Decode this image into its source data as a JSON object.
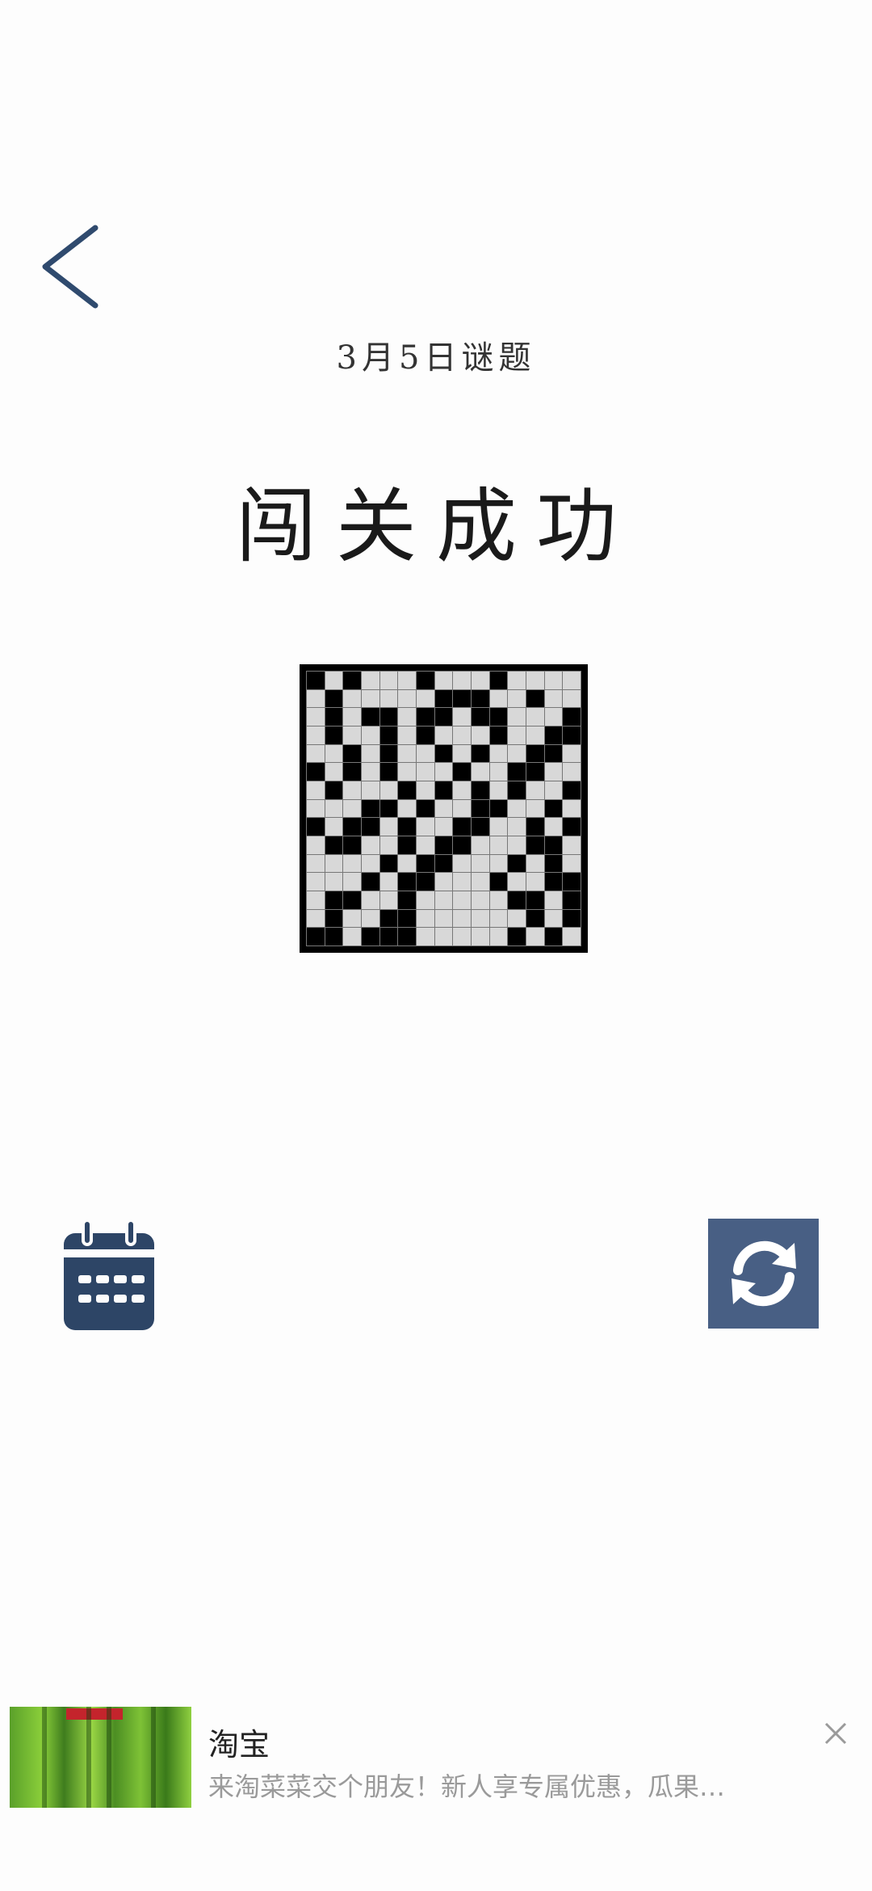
{
  "header": {
    "back_icon": "chevron-left-icon"
  },
  "puzzle": {
    "date_title": "3月5日谜题",
    "status_title": "闯关成功",
    "size": 15,
    "filled_cells": [
      [
        0,
        0
      ],
      [
        0,
        2
      ],
      [
        0,
        6
      ],
      [
        0,
        10
      ],
      [
        1,
        1
      ],
      [
        1,
        7
      ],
      [
        1,
        8
      ],
      [
        1,
        9
      ],
      [
        1,
        12
      ],
      [
        2,
        1
      ],
      [
        2,
        3
      ],
      [
        2,
        4
      ],
      [
        2,
        6
      ],
      [
        2,
        7
      ],
      [
        2,
        9
      ],
      [
        2,
        10
      ],
      [
        2,
        14
      ],
      [
        3,
        1
      ],
      [
        3,
        4
      ],
      [
        3,
        6
      ],
      [
        3,
        10
      ],
      [
        3,
        13
      ],
      [
        3,
        14
      ],
      [
        4,
        2
      ],
      [
        4,
        4
      ],
      [
        4,
        7
      ],
      [
        4,
        9
      ],
      [
        4,
        12
      ],
      [
        4,
        13
      ],
      [
        5,
        0
      ],
      [
        5,
        2
      ],
      [
        5,
        4
      ],
      [
        5,
        8
      ],
      [
        5,
        11
      ],
      [
        5,
        12
      ],
      [
        6,
        1
      ],
      [
        6,
        5
      ],
      [
        6,
        7
      ],
      [
        6,
        9
      ],
      [
        6,
        11
      ],
      [
        6,
        14
      ],
      [
        7,
        3
      ],
      [
        7,
        4
      ],
      [
        7,
        6
      ],
      [
        7,
        9
      ],
      [
        7,
        10
      ],
      [
        7,
        13
      ],
      [
        8,
        0
      ],
      [
        8,
        2
      ],
      [
        8,
        3
      ],
      [
        8,
        5
      ],
      [
        8,
        8
      ],
      [
        8,
        9
      ],
      [
        8,
        12
      ],
      [
        8,
        14
      ],
      [
        9,
        1
      ],
      [
        9,
        2
      ],
      [
        9,
        5
      ],
      [
        9,
        7
      ],
      [
        9,
        8
      ],
      [
        9,
        12
      ],
      [
        9,
        13
      ],
      [
        10,
        4
      ],
      [
        10,
        6
      ],
      [
        10,
        7
      ],
      [
        10,
        11
      ],
      [
        10,
        13
      ],
      [
        11,
        3
      ],
      [
        11,
        5
      ],
      [
        11,
        6
      ],
      [
        11,
        10
      ],
      [
        11,
        13
      ],
      [
        11,
        14
      ],
      [
        12,
        1
      ],
      [
        12,
        2
      ],
      [
        12,
        5
      ],
      [
        12,
        11
      ],
      [
        12,
        12
      ],
      [
        12,
        14
      ],
      [
        13,
        1
      ],
      [
        13,
        4
      ],
      [
        13,
        5
      ],
      [
        13,
        12
      ],
      [
        13,
        14
      ],
      [
        14,
        0
      ],
      [
        14,
        1
      ],
      [
        14,
        3
      ],
      [
        14,
        4
      ],
      [
        14,
        5
      ],
      [
        14,
        11
      ],
      [
        14,
        13
      ]
    ]
  },
  "controls": {
    "calendar_icon": "calendar-icon",
    "refresh_icon": "refresh-icon",
    "accent_color": "#485f84",
    "calendar_color": "#2d4566"
  },
  "ad": {
    "title": "淘宝",
    "description": "来淘菜菜交个朋友！新人享专属优惠，瓜果…",
    "close_icon": "close-icon"
  }
}
